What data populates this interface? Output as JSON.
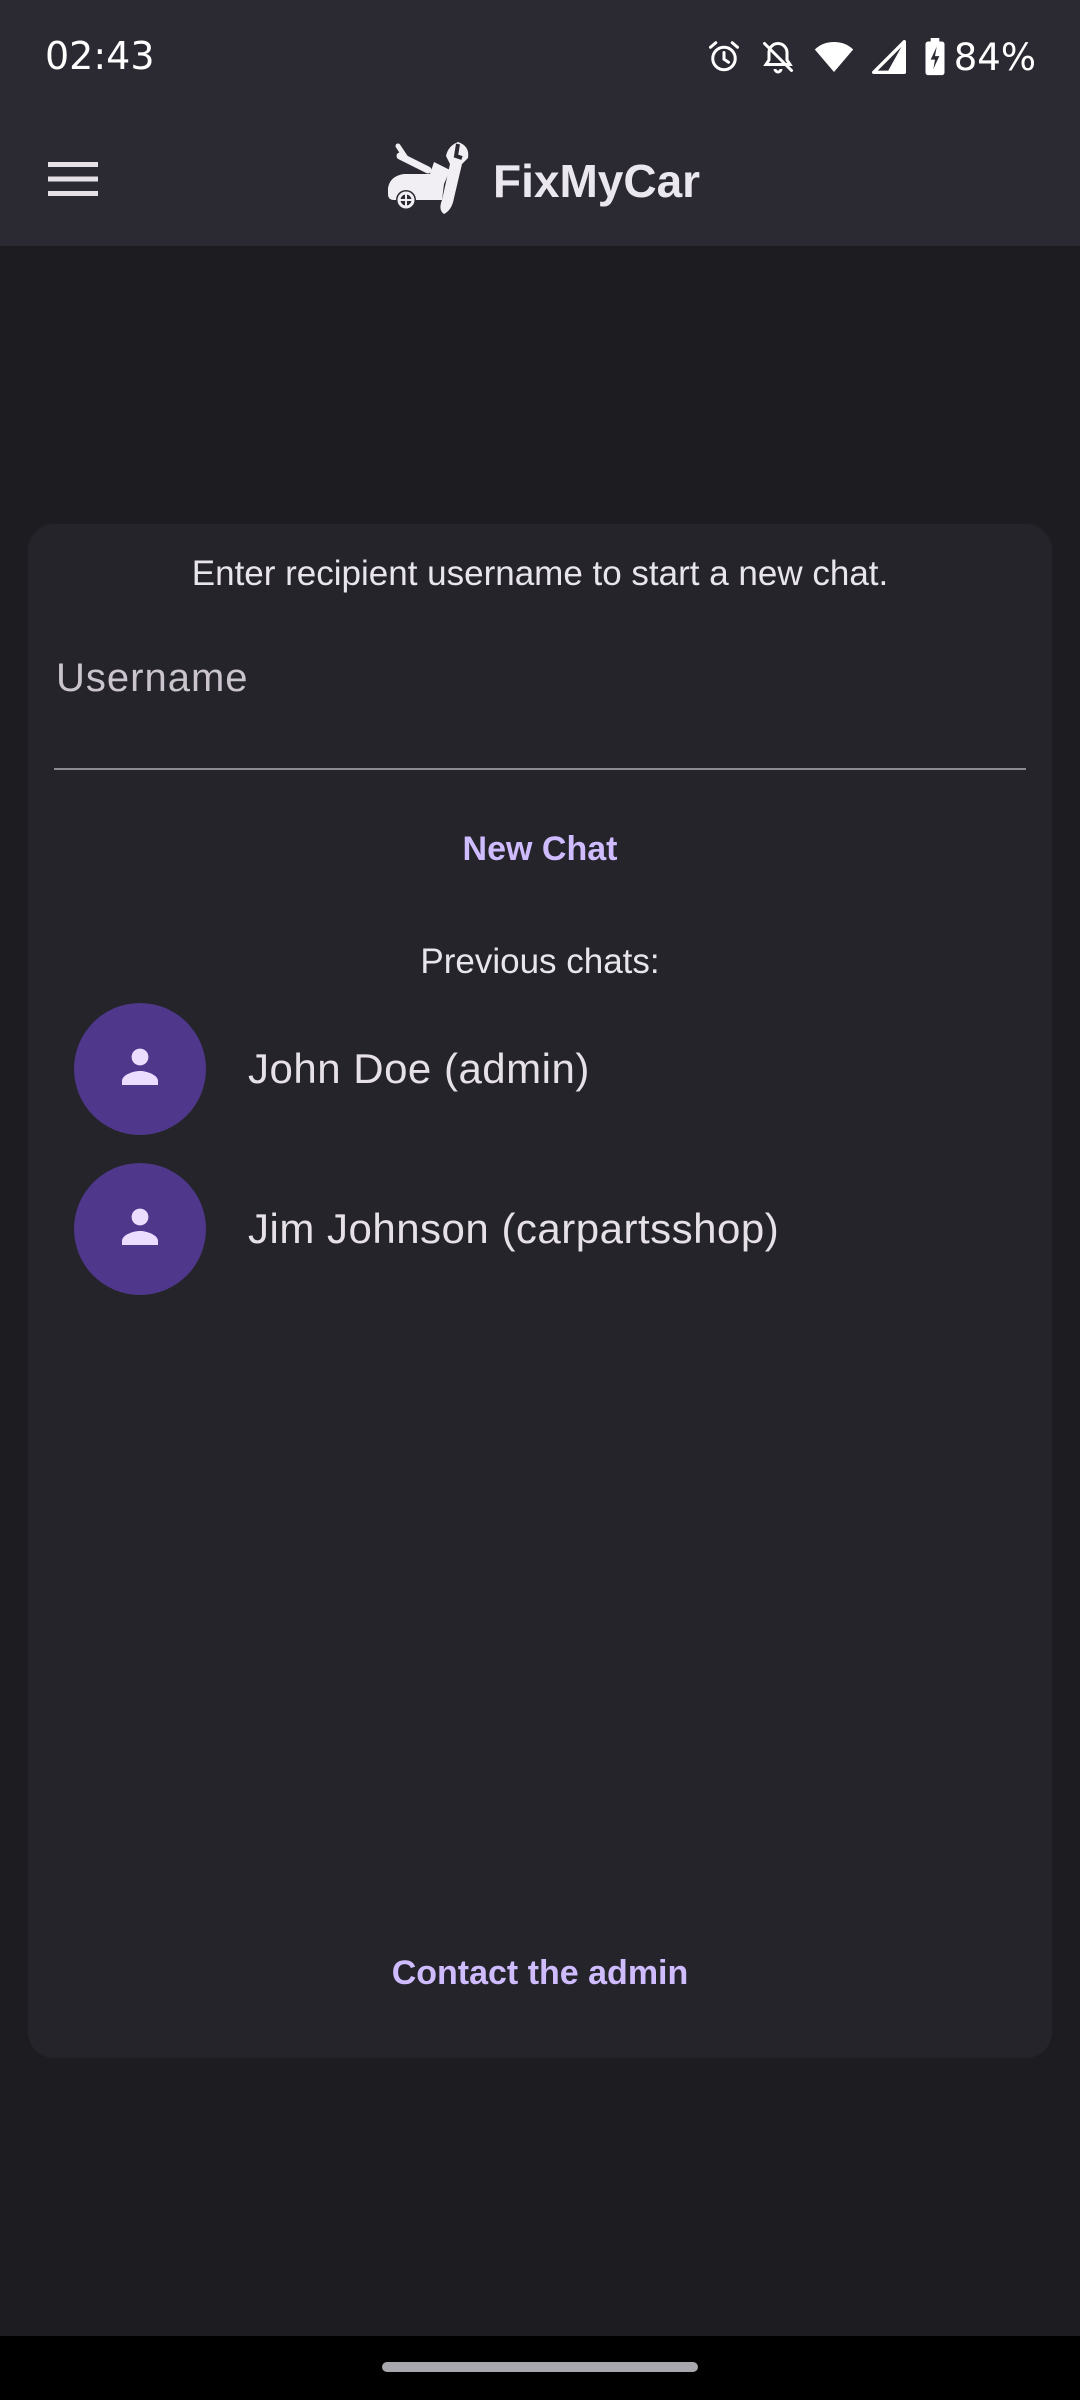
{
  "status_bar": {
    "time": "02:43",
    "battery_percent": "84%",
    "icons": [
      "alarm-icon",
      "notifications-off-icon",
      "wifi-icon",
      "cell-signal-icon",
      "battery-charging-icon"
    ]
  },
  "app_bar": {
    "title": "FixMyCar",
    "menu_icon": "menu-icon",
    "logo_icon": "car-repair-logo-icon"
  },
  "new_chat": {
    "prompt": "Enter recipient username to start a new chat.",
    "username_placeholder": "Username",
    "username_value": "",
    "button_label": "New Chat"
  },
  "previous_chats": {
    "label": "Previous chats:",
    "items": [
      {
        "name": "John Doe (admin)",
        "avatar_icon": "person-icon"
      },
      {
        "name": "Jim Johnson (carpartsshop)",
        "avatar_icon": "person-icon"
      }
    ]
  },
  "footer": {
    "contact_admin_label": "Contact the admin"
  },
  "colors": {
    "background": "#1d1c21",
    "app_bar": "#2b2a33",
    "card": "#25242b",
    "accent": "#cfbcff",
    "avatar": "#4f378b"
  }
}
